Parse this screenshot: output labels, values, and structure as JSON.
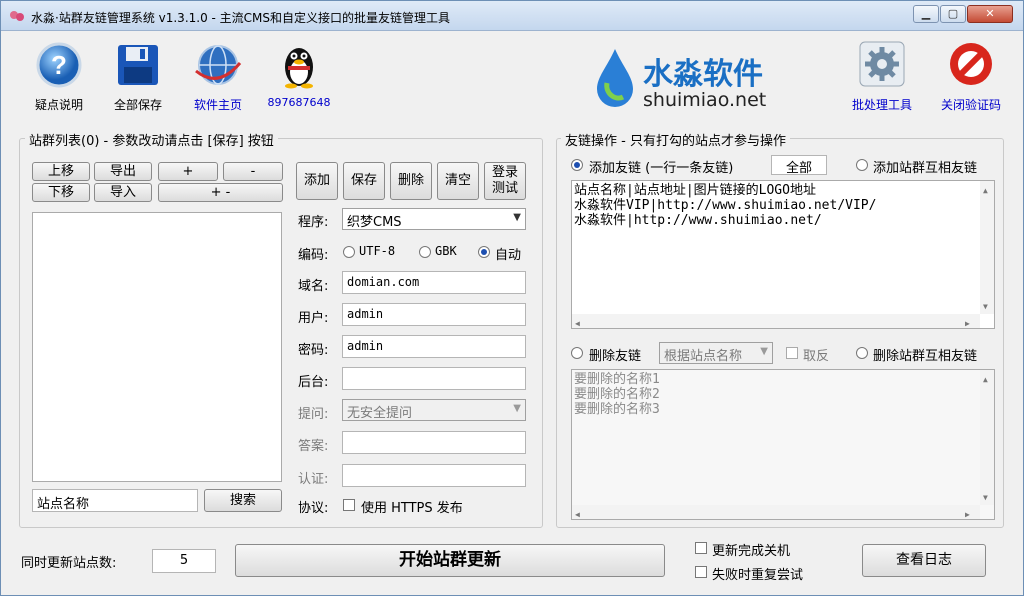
{
  "window": {
    "title": "水淼·站群友链管理系统 v1.3.1.0 - 主流CMS和自定义接口的批量友链管理工具",
    "min": "▁",
    "max": "▢",
    "close": "✕"
  },
  "toolbar": {
    "help_label": "疑点说明",
    "save_all_label": "全部保存",
    "homepage_label": "软件主页",
    "qq_label": "897687648",
    "batch_label": "批处理工具",
    "close_captcha_label": "关闭验证码"
  },
  "brand": {
    "name_cn": "水淼软件",
    "name_en": "shuimiao.net",
    "color": "#1a6fc4"
  },
  "site_list": {
    "title": "站群列表(0) - 参数改动请点击 [保存] 按钮",
    "move_up": "上移",
    "move_down": "下移",
    "export": "导出",
    "import": "导入",
    "plus": "+",
    "minus": "-",
    "plus_minus": "+ -",
    "search_value": "站点名称",
    "search_button": "搜索"
  },
  "site_form": {
    "add": "添加",
    "save": "保存",
    "delete": "删除",
    "clear": "清空",
    "login_test_1": "登录",
    "login_test_2": "测试",
    "program_label": "程序:",
    "program_value": "织梦CMS",
    "encoding_label": "编码:",
    "utf8": "UTF-8",
    "gbk": "GBK",
    "auto": "自动",
    "domain_label": "域名:",
    "domain_value": "domian.com",
    "user_label": "用户:",
    "user_value": "admin",
    "password_label": "密码:",
    "password_value": "admin",
    "backend_label": "后台:",
    "backend_value": "",
    "question_label": "提问:",
    "question_value": "无安全提问",
    "answer_label": "答案:",
    "answer_value": "",
    "auth_label": "认证:",
    "auth_value": "",
    "protocol_label": "协议:",
    "https_label": "使用 HTTPS 发布"
  },
  "link_ops": {
    "title": "友链操作 - 只有打勾的站点才参与操作",
    "add_link_label": "添加友链 (一行一条友链)",
    "all_value": "全部",
    "add_mutual_label": "添加站群互相友链",
    "add_text": [
      "站点名称|站点地址|图片链接的LOGO地址",
      "水淼软件VIP|http://www.shuimiao.net/VIP/",
      "水淼软件|http://www.shuimiao.net/"
    ],
    "delete_link_label": "删除友链",
    "delete_by_value": "根据站点名称",
    "invert_label": "取反",
    "delete_mutual_label": "删除站群互相友链",
    "delete_text": [
      "要删除的名称1",
      "要删除的名称2",
      "要删除的名称3"
    ]
  },
  "bottom": {
    "concurrency_label": "同时更新站点数:",
    "concurrency_value": "5",
    "start_button": "开始站群更新",
    "shutdown_label": "更新完成关机",
    "retry_label": "失败时重复尝试",
    "view_log_button": "查看日志"
  }
}
